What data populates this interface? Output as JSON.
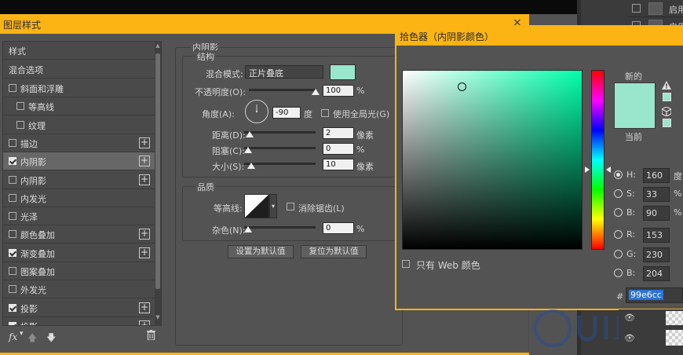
{
  "background_app": {
    "layers": [
      {
        "label": "启用"
      },
      {
        "label": "启用"
      }
    ]
  },
  "layer_style": {
    "title": "图层样式",
    "close": "×",
    "styles_header": "样式",
    "blend_options": "混合选项",
    "items": [
      {
        "label": "斜面和浮雕",
        "checked": false,
        "plus": false,
        "indent": false
      },
      {
        "label": "等高线",
        "checked": false,
        "plus": false,
        "indent": true
      },
      {
        "label": "纹理",
        "checked": false,
        "plus": false,
        "indent": true
      },
      {
        "label": "描边",
        "checked": false,
        "plus": true,
        "indent": false
      },
      {
        "label": "内阴影",
        "checked": true,
        "plus": true,
        "indent": false,
        "selected": true
      },
      {
        "label": "内阴影",
        "checked": false,
        "plus": true,
        "indent": false
      },
      {
        "label": "内发光",
        "checked": false,
        "plus": false,
        "indent": false
      },
      {
        "label": "光泽",
        "checked": false,
        "plus": false,
        "indent": false
      },
      {
        "label": "颜色叠加",
        "checked": false,
        "plus": true,
        "indent": false
      },
      {
        "label": "渐变叠加",
        "checked": true,
        "plus": true,
        "indent": false
      },
      {
        "label": "图案叠加",
        "checked": false,
        "plus": false,
        "indent": false
      },
      {
        "label": "外发光",
        "checked": false,
        "plus": false,
        "indent": false
      },
      {
        "label": "投影",
        "checked": true,
        "plus": true,
        "indent": false
      },
      {
        "label": "投影",
        "checked": true,
        "plus": true,
        "indent": false
      }
    ],
    "fx_label": "fx",
    "inner_shadow": {
      "section_title": "内阴影",
      "structure_title": "结构",
      "blend_mode_label": "混合模式:",
      "blend_mode_value": "正片叠底",
      "blend_color": "#99e6cc",
      "opacity_label": "不透明度(O):",
      "opacity_value": "100",
      "opacity_unit": "%",
      "opacity_level": 1.0,
      "angle_label": "角度(A):",
      "angle_value": "-90",
      "angle_unit": "度",
      "global_light_label": "使用全局光(G)",
      "global_light_checked": false,
      "distance_label": "距离(D):",
      "distance_value": "2",
      "distance_unit": "像素",
      "distance_level": 0.02,
      "choke_label": "阻塞(C):",
      "choke_value": "0",
      "choke_unit": "%",
      "choke_level": 0.0,
      "size_label": "大小(S):",
      "size_value": "10",
      "size_unit": "像素",
      "size_level": 0.04,
      "quality_title": "品质",
      "contour_label": "等高线:",
      "antialias_label": "消除锯齿(L)",
      "antialias_checked": false,
      "noise_label": "杂色(N):",
      "noise_value": "0",
      "noise_unit": "%",
      "noise_level": 0.0,
      "btn_set_default": "设置为默认值",
      "btn_reset_default": "复位为默认值"
    }
  },
  "color_picker": {
    "title": "拾色器（内阴影颜色）",
    "new_label": "新的",
    "current_label": "当前",
    "web_only_label": "只有 Web 颜色",
    "web_only_checked": false,
    "hue_deg": 160,
    "fields": [
      {
        "key": "H",
        "label": "H:",
        "value": "160",
        "unit": "度",
        "selected": true
      },
      {
        "key": "S",
        "label": "S:",
        "value": "33",
        "unit": "%",
        "selected": false
      },
      {
        "key": "B",
        "label": "B:",
        "value": "90",
        "unit": "%",
        "selected": false
      },
      {
        "key": "R",
        "label": "R:",
        "value": "153",
        "unit": "",
        "selected": false
      },
      {
        "key": "G",
        "label": "G:",
        "value": "230",
        "unit": "",
        "selected": false
      },
      {
        "key": "Bl",
        "label": "B:",
        "value": "204",
        "unit": "",
        "selected": false
      }
    ],
    "hex_label": "#",
    "hex_value": "99e6cc",
    "new_color": "#99e6cc",
    "current_color": "#99e6cc"
  },
  "colors": {
    "title_bar": "#fbb413",
    "panel_bg": "#535353",
    "selected_row": "#676767"
  }
}
